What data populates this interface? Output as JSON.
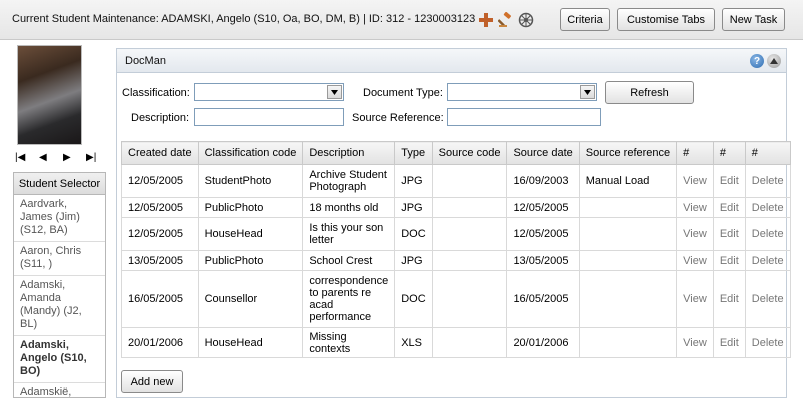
{
  "header": {
    "title": "Current Student Maintenance: ADAMSKI, Angelo (S10, Oa, BO, DM, B) | ID: 312 - 1230003123",
    "icons": [
      "add-icon",
      "gavel-icon",
      "settings-wheel-icon"
    ],
    "buttons": {
      "criteria": "Criteria",
      "customise_tabs": "Customise Tabs",
      "new_task": "New Task"
    }
  },
  "left": {
    "nav": {
      "first": "|◀",
      "prev": "◀",
      "next": "▶",
      "last": "▶|"
    },
    "selector_title": "Student Selector",
    "students": [
      {
        "name": "Aardvark,\nJames (Jim)\n(S12, BA)",
        "active": false
      },
      {
        "name": "Aaron, Chris\n(S11, )",
        "active": false
      },
      {
        "name": "Adamski,\nAmanda\n(Mandy) (J2,\nBL)",
        "active": false
      },
      {
        "name": "Adamski,\nAngelo (S10,\nBO)",
        "active": true
      },
      {
        "name": "Adamskië,\nWilliamä (ëä)",
        "active": false
      }
    ]
  },
  "docman": {
    "title": "DocMan",
    "help": "?",
    "filters": {
      "classification_label": "Classification:",
      "classification_value": "",
      "document_type_label": "Document Type:",
      "document_type_value": "",
      "description_label": "Description:",
      "description_value": "",
      "source_reference_label": "Source Reference:",
      "source_reference_value": "",
      "refresh": "Refresh"
    },
    "columns": [
      "Created date",
      "Classification code",
      "Description",
      "Type",
      "Source code",
      "Source date",
      "Source reference",
      "#",
      "#",
      "#"
    ],
    "rows": [
      {
        "created": "12/05/2005",
        "classification": "StudentPhoto",
        "description": "Archive Student Photograph",
        "type": "JPG",
        "source_code": "",
        "source_date": "16/09/2003",
        "source_ref": "Manual Load",
        "view": "View",
        "edit": "Edit",
        "delete": "Delete"
      },
      {
        "created": "12/05/2005",
        "classification": "PublicPhoto",
        "description": "18 months old",
        "type": "JPG",
        "source_code": "",
        "source_date": "12/05/2005",
        "source_ref": "",
        "view": "View",
        "edit": "Edit",
        "delete": "Delete"
      },
      {
        "created": "12/05/2005",
        "classification": "HouseHead",
        "description": "Is this your son letter",
        "type": "DOC",
        "source_code": "",
        "source_date": "12/05/2005",
        "source_ref": "",
        "view": "View",
        "edit": "Edit",
        "delete": "Delete"
      },
      {
        "created": "13/05/2005",
        "classification": "PublicPhoto",
        "description": "School Crest",
        "type": "JPG",
        "source_code": "",
        "source_date": "13/05/2005",
        "source_ref": "",
        "view": "View",
        "edit": "Edit",
        "delete": "Delete"
      },
      {
        "created": "16/05/2005",
        "classification": "Counsellor",
        "description": "correspondence to parents re acad performance",
        "type": "DOC",
        "source_code": "",
        "source_date": "16/05/2005",
        "source_ref": "",
        "view": "View",
        "edit": "Edit",
        "delete": "Delete"
      },
      {
        "created": "20/01/2006",
        "classification": "HouseHead",
        "description": "Missing contexts",
        "type": "XLS",
        "source_code": "",
        "source_date": "20/01/2006",
        "source_ref": "",
        "view": "View",
        "edit": "Edit",
        "delete": "Delete"
      }
    ],
    "add_new": "Add new"
  }
}
